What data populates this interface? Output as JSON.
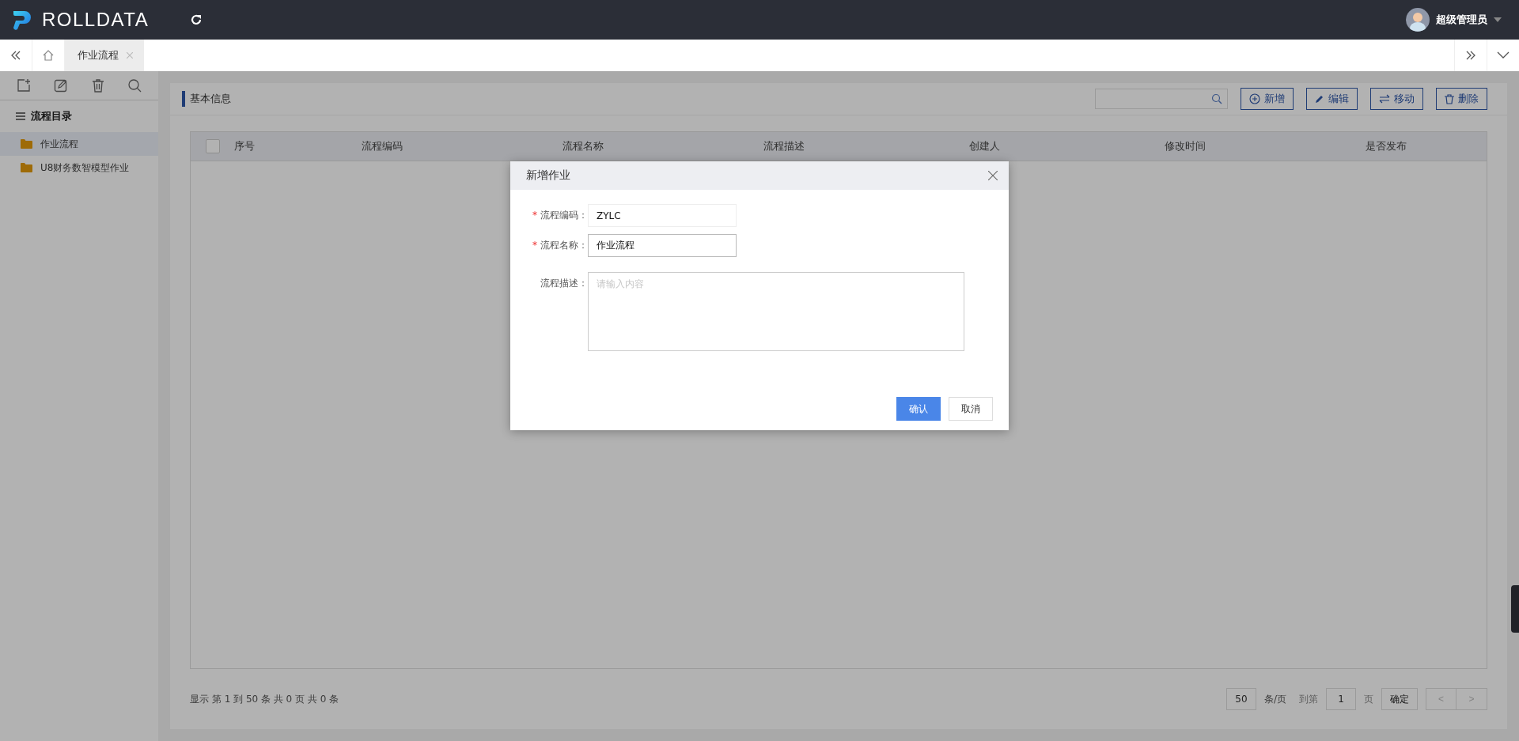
{
  "header": {
    "logo_text": "ROLLDATA",
    "user": "超级管理员"
  },
  "tabs": [
    {
      "label": "作业流程",
      "selected": true
    }
  ],
  "sidebar": {
    "title": "流程目录",
    "items": [
      {
        "label": "作业流程",
        "selected": true
      },
      {
        "label": "U8财务数智模型作业",
        "selected": false
      }
    ]
  },
  "panel": {
    "title": "基本信息",
    "buttons": [
      {
        "label": "新增",
        "kind": "add"
      },
      {
        "label": "编辑",
        "kind": "edit"
      },
      {
        "label": "移动",
        "kind": "move"
      },
      {
        "label": "删除",
        "kind": "delete"
      }
    ]
  },
  "table": {
    "select_all_checked": false,
    "columns": [
      "序号",
      "流程编码",
      "流程名称",
      "流程描述",
      "创建人",
      "修改时间",
      "是否发布"
    ]
  },
  "pagination": {
    "summary": "显示 第 1 到 50 条 共 0 页 共 0 条",
    "page_size": "50",
    "per_page": "条/页",
    "goto": "到第",
    "page": "1",
    "page_unit": "页",
    "confirm": "确定",
    "prev": "<",
    "next": ">"
  },
  "dialog": {
    "title": "新增作业",
    "fields": [
      {
        "label": "流程编码：",
        "mark": "*",
        "kind": "input",
        "value": "ZYLC",
        "focused": false
      },
      {
        "label": "流程名称：",
        "mark": "*",
        "kind": "input",
        "value": "作业流程",
        "focused": true
      },
      {
        "label": "流程描述：",
        "kind": "textarea",
        "placeholder": "请输入内容",
        "focused": false
      }
    ],
    "buttons": [
      {
        "label": "确认",
        "kind": "primary"
      },
      {
        "label": "取消",
        "kind": "default"
      }
    ]
  }
}
